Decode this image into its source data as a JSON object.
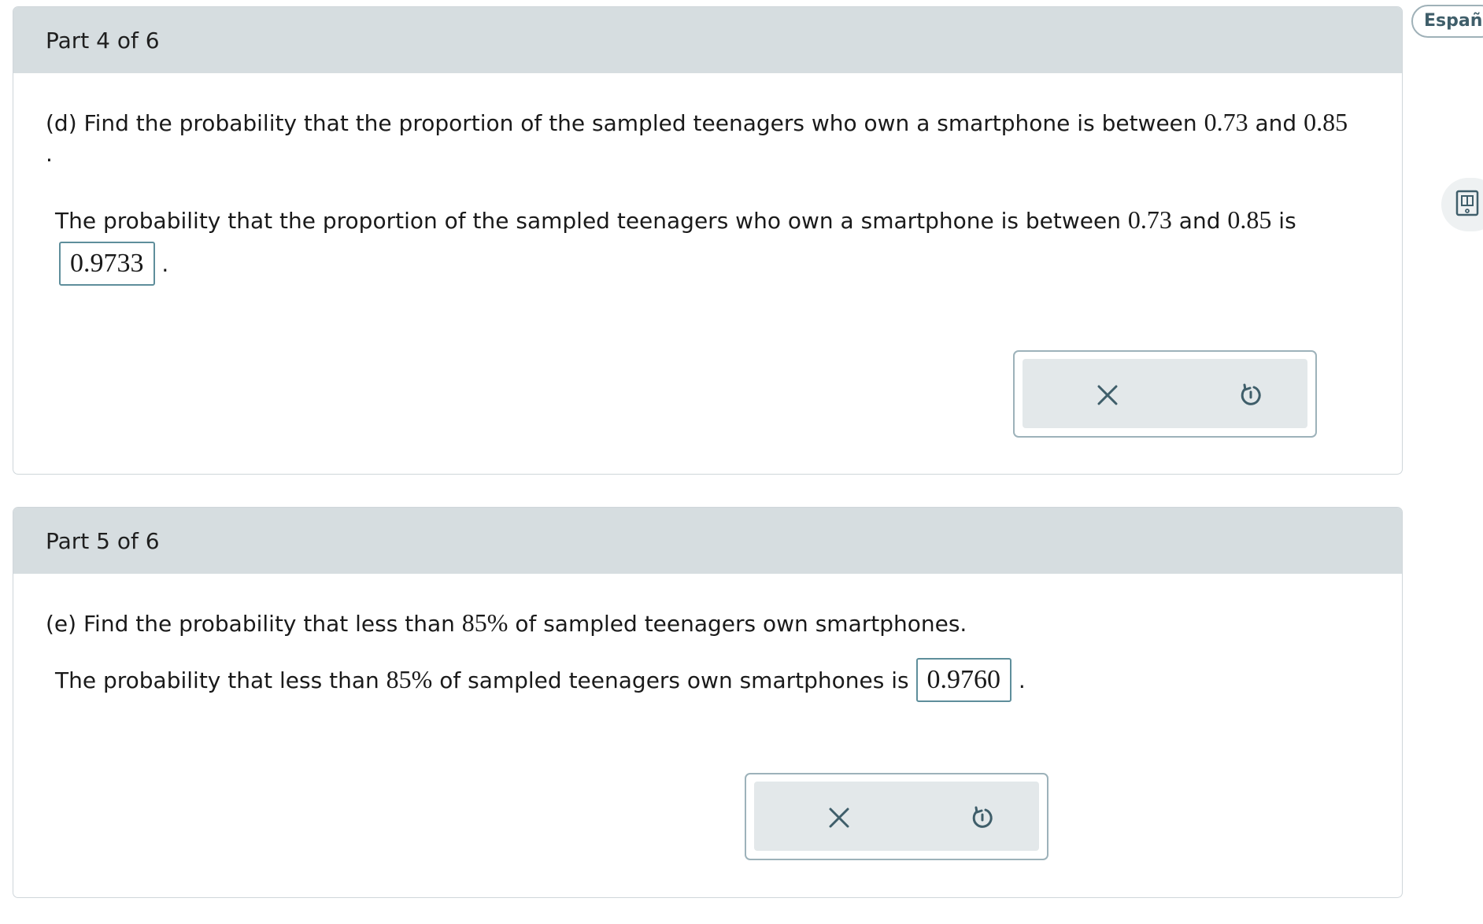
{
  "language_button": {
    "label": "Españo"
  },
  "side_tool": {
    "icon": "book-icon"
  },
  "parts": [
    {
      "header": "Part 4 of 6",
      "question": {
        "prefix": "(d) Find the probability that the proportion of the sampled teenagers who own a smartphone is between",
        "value1": "0.73",
        "connector": "and",
        "value2": "0.85",
        "trailing": "."
      },
      "answer_line": {
        "prefix": "The probability that the proportion of the sampled teenagers who own a smartphone is between",
        "value1": "0.73",
        "connector": "and",
        "value2": "0.85",
        "suffix": "is",
        "answer": "0.9733",
        "end": "."
      },
      "actions": {
        "clear_icon": "close-icon",
        "reset_icon": "undo-icon"
      }
    },
    {
      "header": "Part 5 of 6",
      "question": {
        "prefix": "(e) Find the probability that less than",
        "percent": "85%",
        "suffix": "of sampled teenagers own smartphones."
      },
      "answer_line": {
        "prefix": "The probability that less than",
        "percent": "85%",
        "suffix": "of sampled teenagers own smartphones is",
        "answer": "0.9760",
        "end": "."
      },
      "actions": {
        "clear_icon": "close-icon",
        "reset_icon": "undo-icon"
      }
    }
  ],
  "colors": {
    "header_bg": "#d6dde0",
    "border": "#cfd6da",
    "answer_border": "#5e8e9b",
    "icon": "#3f5e6a",
    "action_bg": "#e3e8ea"
  }
}
